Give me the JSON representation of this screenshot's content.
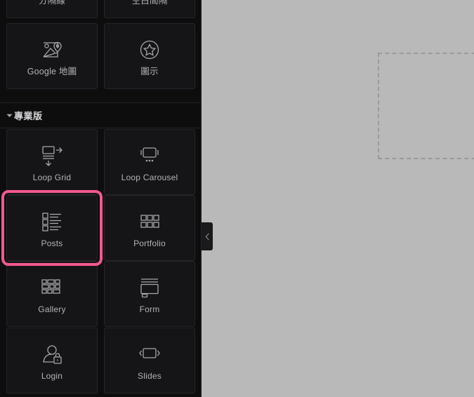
{
  "app": {
    "panel_name": "elementor-widget-panel",
    "accent_highlight": "#f4588e",
    "panel_bg": "#0d0d0e",
    "card_bg": "#151517",
    "canvas_bg": "#b9b9b9",
    "label_color": "#b4b4b8"
  },
  "canvas": {
    "dropzone_label": ""
  },
  "collapse_handle": {
    "icon": "chevron-left-icon",
    "label": "‹"
  },
  "sections": [
    {
      "id": "basic-clipped",
      "header": null,
      "widgets": [
        {
          "label": "分隔線",
          "icon": "divider-icon",
          "highlighted": false
        },
        {
          "label": "空白間隔",
          "icon": "spacer-icon",
          "highlighted": false
        },
        {
          "label": "Google 地圖",
          "icon": "google-map-icon",
          "highlighted": false
        },
        {
          "label": "圖示",
          "icon": "star-circle-icon",
          "highlighted": false
        }
      ]
    },
    {
      "id": "pro",
      "header": {
        "title": "專業版",
        "caret": "caret-down-icon",
        "expanded": true
      },
      "widgets": [
        {
          "label": "Loop Grid",
          "icon": "loop-grid-icon",
          "highlighted": false
        },
        {
          "label": "Loop Carousel",
          "icon": "loop-carousel-icon",
          "highlighted": false
        },
        {
          "label": "Posts",
          "icon": "posts-list-icon",
          "highlighted": true
        },
        {
          "label": "Portfolio",
          "icon": "portfolio-grid-icon",
          "highlighted": false
        },
        {
          "label": "Gallery",
          "icon": "gallery-icon",
          "highlighted": false
        },
        {
          "label": "Form",
          "icon": "form-icon",
          "highlighted": false
        },
        {
          "label": "Login",
          "icon": "login-user-lock-icon",
          "highlighted": false
        },
        {
          "label": "Slides",
          "icon": "slides-icon",
          "highlighted": false
        }
      ]
    }
  ]
}
